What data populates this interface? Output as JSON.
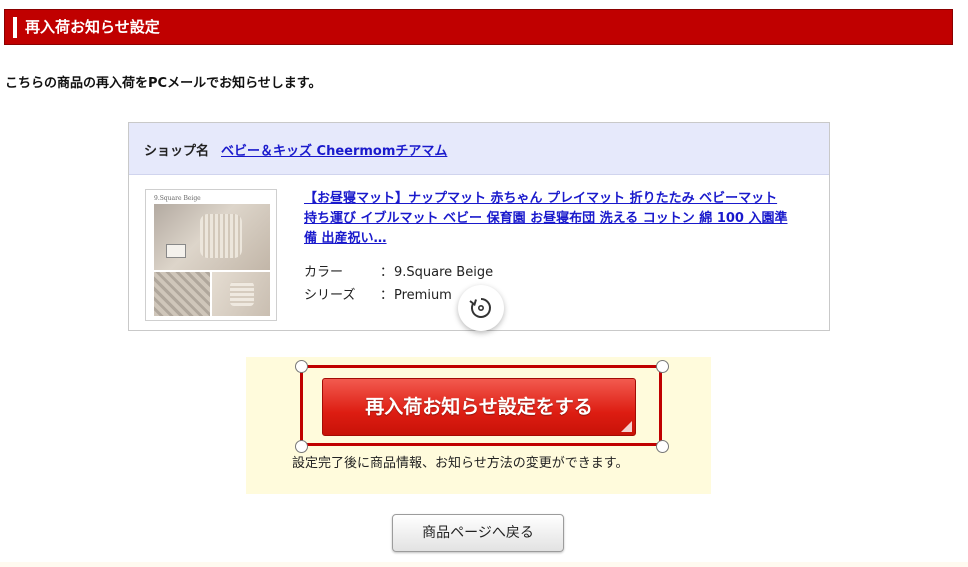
{
  "header": {
    "title": "再入荷お知らせ設定"
  },
  "intro": {
    "text": "こちらの商品の再入荷をPCメールでお知らせします。"
  },
  "shop": {
    "label": "ショップ名",
    "name": "ベビー＆キッズ Cheermomチアマム"
  },
  "product": {
    "thumbnail_caption": "9.Square Beige",
    "title_lines": [
      "【お昼寝マット】ナップマット 赤ちゃん プレイマット 折りたたみ ベビーマット",
      "持ち運び イブルマット ベビー 保育園 お昼寝布団 洗える コットン 綿 100 入園準",
      "備 出産祝い…"
    ],
    "specs": [
      {
        "label": "カラー",
        "value": "9.Square Beige"
      },
      {
        "label": "シリーズ",
        "value": "Premium"
      }
    ]
  },
  "cta": {
    "button_label": "再入荷お知らせ設定をする",
    "note": "設定完了後に商品情報、お知らせ方法の変更ができます。"
  },
  "back": {
    "label": "商品ページへ戻る"
  },
  "colors": {
    "header_red": "#c00000",
    "link_blue": "#1a1acc",
    "shop_header_bg": "#e6e9fb",
    "cta_panel_bg": "#fffbdc",
    "cta_red": "#dd1d12"
  }
}
